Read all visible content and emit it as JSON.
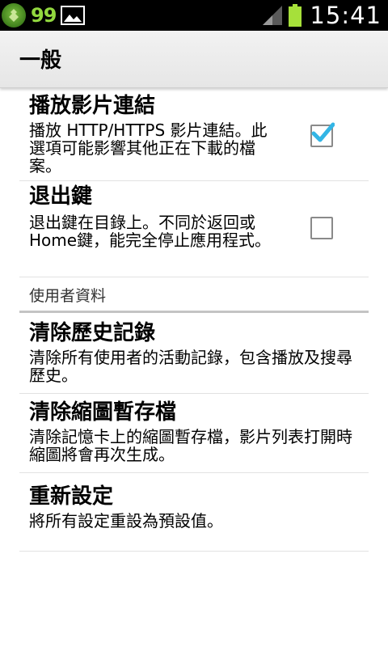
{
  "status_bar": {
    "notification_count": "99",
    "time": "15:41",
    "icons": [
      "app-badge-icon",
      "image-icon",
      "signal-icon",
      "battery-icon"
    ],
    "battery_color": "#a6e03a"
  },
  "header": {
    "title": "一般"
  },
  "settings": {
    "play_video_link": {
      "title": "播放影片連結",
      "summary": "播放 HTTP/HTTPS 影片連結。此選項可能影響其他正在下載的檔案。",
      "checked": true
    },
    "exit_key": {
      "title": "退出鍵",
      "summary": "退出鍵在目錄上。不同於返回或Home鍵，能完全停止應用程式。",
      "checked": false
    },
    "user_data_category": "使用者資料",
    "clear_history": {
      "title": "清除歷史記錄",
      "summary": "清除所有使用者的活動記錄，包含播放及搜尋歷史。"
    },
    "clear_thumbnails": {
      "title": "清除縮圖暫存檔",
      "summary": "清除記憶卡上的縮圖暫存檔，影片列表打開時縮圖將會再次生成。"
    },
    "reset": {
      "title": "重新設定",
      "summary": "將所有設定重設為預設值。"
    }
  },
  "colors": {
    "check_accent": "#33b5e5",
    "header_bg": "#ececec"
  }
}
